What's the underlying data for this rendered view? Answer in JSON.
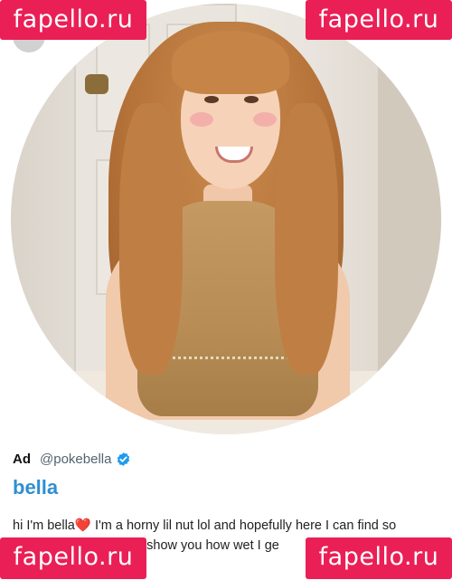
{
  "watermark": {
    "text": "fapello.ru",
    "color": "#ea1f56"
  },
  "profile_photo": {
    "alt_icon": "portrait-photo"
  },
  "ad": {
    "label": "Ad",
    "handle": "@pokebella",
    "verified_icon": "verified-badge-icon",
    "verified_color": "#1d9bf0",
    "display_name": "bella",
    "display_name_color": "#2f8fd1",
    "bio_line1_a": "hi I'm bella",
    "bio_heart": "❤️",
    "bio_line1_b": " I'm a horny lil nut lol and hopefully here I can find so",
    "bio_line2": "nd show you how wet I ge"
  }
}
